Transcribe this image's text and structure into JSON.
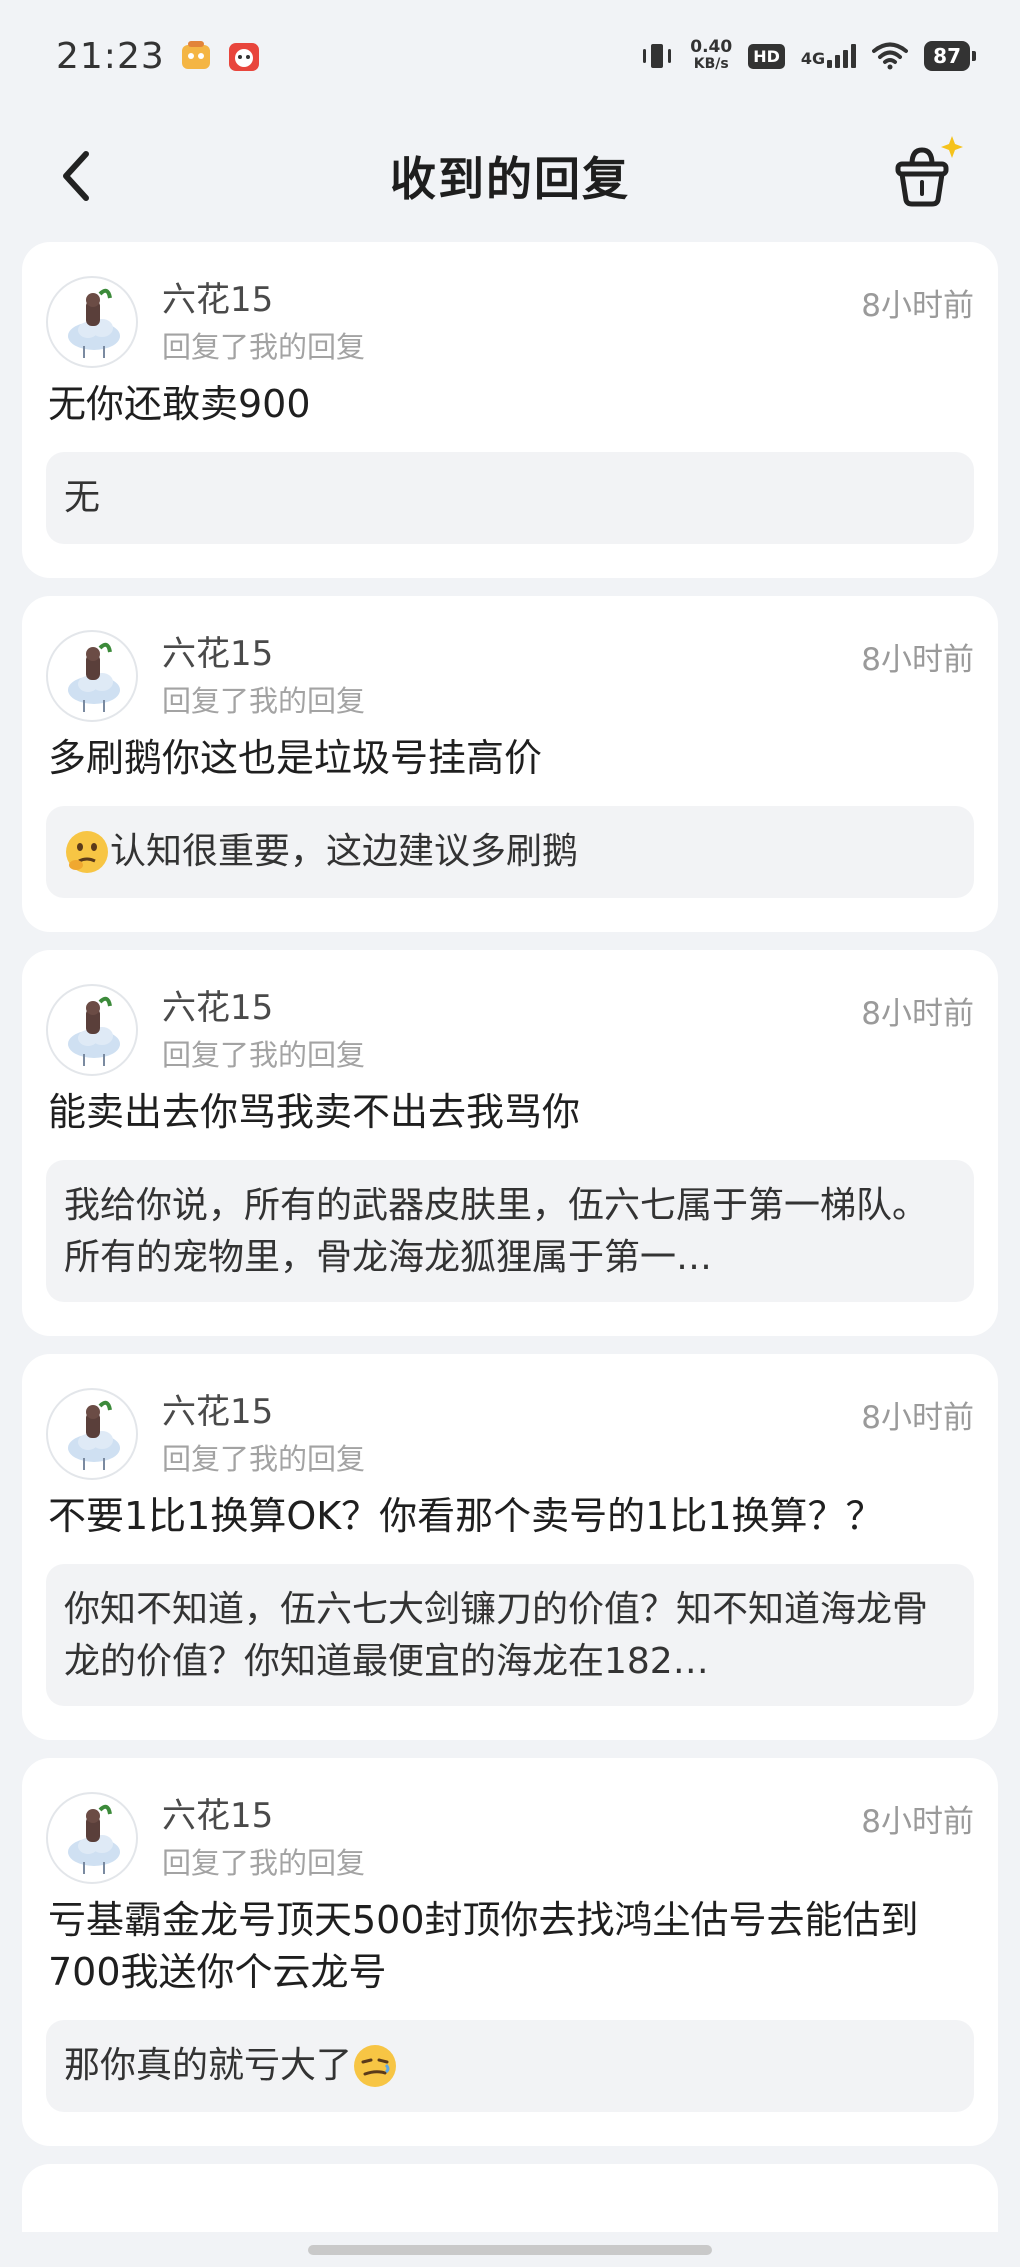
{
  "status_bar": {
    "time": "21:23",
    "net_speed_value": "0.40",
    "net_speed_unit": "KB/s",
    "hd": "HD",
    "net_type": "4G",
    "battery": "87"
  },
  "header": {
    "title": "收到的回复",
    "back_icon": "chevron-left-icon",
    "basket_icon": "basket-sparkle-icon"
  },
  "replies": [
    {
      "username": "六花15",
      "action": "回复了我的回复",
      "time": "8小时前",
      "text": "无你还敢卖900",
      "quote": "无"
    },
    {
      "username": "六花15",
      "action": "回复了我的回复",
      "time": "8小时前",
      "text": "多刷鹅你这也是垃圾号挂高价",
      "quote": "认知很重要，这边建议多刷鹅",
      "quote_emoji": "thinking-face-emoji"
    },
    {
      "username": "六花15",
      "action": "回复了我的回复",
      "time": "8小时前",
      "text": "能卖出去你骂我卖不出去我骂你",
      "quote": "我给你说，所有的武器皮肤里，伍六七属于第一梯队。所有的宠物里，骨龙海龙狐狸属于第一…"
    },
    {
      "username": "六花15",
      "action": "回复了我的回复",
      "time": "8小时前",
      "text": "不要1比1换算OK？你看那个卖号的1比1换算？？",
      "quote": "你知不知道，伍六七大剑镰刀的价值？知不知道海龙骨龙的价值？你知道最便宜的海龙在182…"
    },
    {
      "username": "六花15",
      "action": "回复了我的回复",
      "time": "8小时前",
      "text": "亏基霸金龙号顶天500封顶你去找鸿尘估号去能估到700我送你个云龙号",
      "quote": "那你真的就亏大了",
      "quote_emoji": "smirk-face-emoji"
    }
  ],
  "colors": {
    "background": "#f1f3f6",
    "card": "#ffffff",
    "quote_bg": "#f2f3f5",
    "muted_text": "#a3a3a3"
  }
}
